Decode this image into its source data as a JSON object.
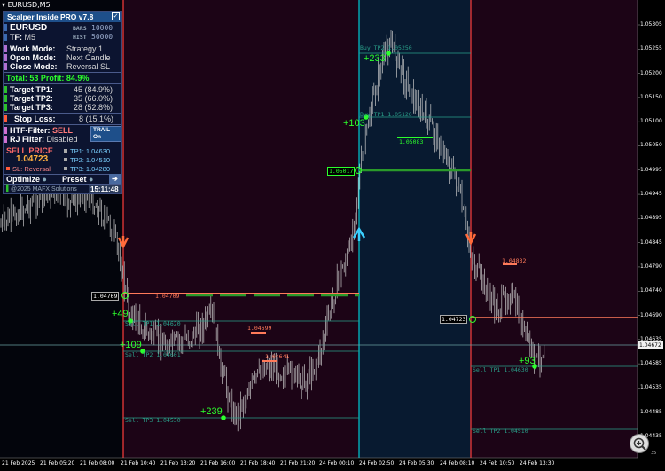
{
  "window": {
    "title": "EURUSD,M5"
  },
  "panel": {
    "title": "Scalper Inside PRO v7.8",
    "symbol": "EURUSD",
    "timeframe_label": "TF:",
    "timeframe": "M5",
    "bars_label": "BARS",
    "bars_value": "10000",
    "hist_label": "HIST",
    "hist_value": "50000",
    "work_mode_label": "Work  Mode:",
    "work_mode_value": "Strategy 1",
    "open_mode_label": "Open Mode:",
    "open_mode_value": "Next Candle",
    "close_mode_label": "Close Mode:",
    "close_mode_value": "Reversal SL",
    "total": "Total: 53  Profit: 84.9%",
    "tp1_label": "Target TP1:",
    "tp1_value": "45 (84.9%)",
    "tp2_label": "Target TP2:",
    "tp2_value": "35 (66.0%)",
    "tp3_label": "Target TP3:",
    "tp3_value": "28 (52.8%)",
    "sl_label": "Stop Loss:",
    "sl_value": "8 (15.1%)",
    "htf_label": "HTF-Filter:",
    "htf_value": "SELL",
    "trail_label": "TRAIL On",
    "rj_label": "RJ Filter:",
    "rj_value": "Disabled",
    "sell_price_label": "SELL PRICE",
    "sell_price_value": "1.04723",
    "sl_mode": "SL: Reversal",
    "ptp1": "TP1: 1.04630",
    "ptp2": "TP2: 1.04510",
    "ptp3": "TP3: 1.04280",
    "optimize_label": "Optimize",
    "preset_label": "Preset",
    "footer": "@2025 MAFX Solutions",
    "clock": "15:11:48"
  },
  "chart_data": {
    "type": "candlestick",
    "symbol": "EURUSD",
    "timeframe": "M5",
    "ylim": [
      1.04385,
      1.05355
    ],
    "y_ticks": [
      "1.05305",
      "1.05255",
      "1.05200",
      "1.05150",
      "1.05100",
      "1.05050",
      "1.04995",
      "1.04945",
      "1.04895",
      "1.04845",
      "1.04790",
      "1.04740",
      "1.04690",
      "1.04635",
      "1.04585",
      "1.04535",
      "1.04485",
      "1.04435"
    ],
    "x_ticks": [
      "21 Feb 2025",
      "21 Feb 05:20",
      "21 Feb 08:00",
      "21 Feb 10:40",
      "21 Feb 13:20",
      "21 Feb 16:00",
      "21 Feb 18:40",
      "21 Feb 21:20",
      "24 Feb 00:10",
      "24 Feb 02:50",
      "24 Feb 05:30",
      "24 Feb 08:10",
      "24 Feb 10:50",
      "24 Feb 13:30"
    ],
    "current_price": "1.04672",
    "trades": [
      {
        "side": "sell",
        "entry": "1.04769",
        "tp1_text": "Sell TP1 1.04620",
        "tp2_text": "Sell TP2 1.04601",
        "tp3_text": "Sell TP3 1.04530",
        "pips": [
          "+49",
          "+109",
          "+239"
        ]
      },
      {
        "side": "buy",
        "entry": "1.05017",
        "tp1_text": "Buy TP1 1.05120",
        "tp2_text": "Buy TP2 1.05250",
        "pips": [
          "+103",
          "+233"
        ]
      },
      {
        "side": "sell",
        "entry": "1.04723",
        "tp1_text": "Sell TP1 1.04630",
        "tp2_text": "Sell TP2 1.04510",
        "pips": [
          "+93"
        ]
      }
    ],
    "level_labels": [
      "1.04709",
      "1.04699",
      "1.04641",
      "1.05083",
      "1.04832"
    ],
    "corner_text": "35"
  },
  "colors": {
    "buy_zone": "#0a1a2e",
    "sell_zone": "#1e0418",
    "sell_line": "#ff3c3c",
    "buy_line": "#00c8d0",
    "tp_line": "#2aa08a",
    "profit_text": "#2cff2c"
  }
}
